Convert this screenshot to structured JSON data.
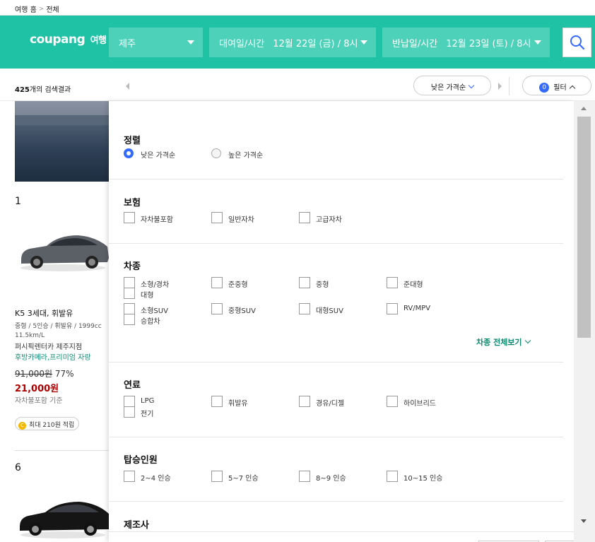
{
  "breadcrumb": {
    "home": "여행 홈",
    "current": "전체"
  },
  "header": {
    "logo": "coupang",
    "logo_sub": "여행",
    "location": "제주",
    "pickup_label": "대여일/시간",
    "pickup_value": "12월 22일 (금) / 8시",
    "return_label": "반납일/시간",
    "return_value": "12월 23일 (토) / 8시",
    "brand_color": "#1fc2a5"
  },
  "results": {
    "count": "425",
    "suffix": "개의 검색결과",
    "sort_label": "낮은 가격순",
    "filter_count": "0",
    "filter_label": "필터"
  },
  "list": {
    "rank1": "1",
    "rank2": "6",
    "car": {
      "title": "K5 3세대, 휘발유",
      "spec": "중형 / 5인승 / 휘발유 / 1999cc",
      "spec2": "11.5km/L",
      "shop": "퍼시픽렌터카 제주지점",
      "insurance": "후방카메라,프리미엄 자랑",
      "original_price": "91,000원",
      "discount": "77%",
      "price": "21,000원",
      "note": "자차불포함 기준",
      "cashback": "최대 210원 적립",
      "coin": "C"
    }
  },
  "filters": {
    "sort": {
      "title": "정렬",
      "options": [
        "낮은 가격순",
        "높은 가격순"
      ],
      "selected": 0
    },
    "insurance": {
      "title": "보험",
      "options": [
        "자차불포함",
        "일반자차",
        "고급자차"
      ]
    },
    "car_type": {
      "title": "차종",
      "options": [
        "소형/경차",
        "대형",
        "준중형",
        "중형",
        "준대형",
        "소형SUV",
        "승합차",
        "중형SUV",
        "대형SUV",
        "RV/MPV"
      ],
      "see_all": "차종 전체보기"
    },
    "fuel": {
      "title": "연료",
      "options": [
        "LPG",
        "전기",
        "휘발유",
        "경유/디젤",
        "하이브리드"
      ]
    },
    "seats": {
      "title": "탑승인원",
      "options": [
        "2~4 인승",
        "5~7 인승",
        "8~9 인승",
        "10~15 인승"
      ]
    },
    "maker": {
      "title": "제조사"
    }
  }
}
